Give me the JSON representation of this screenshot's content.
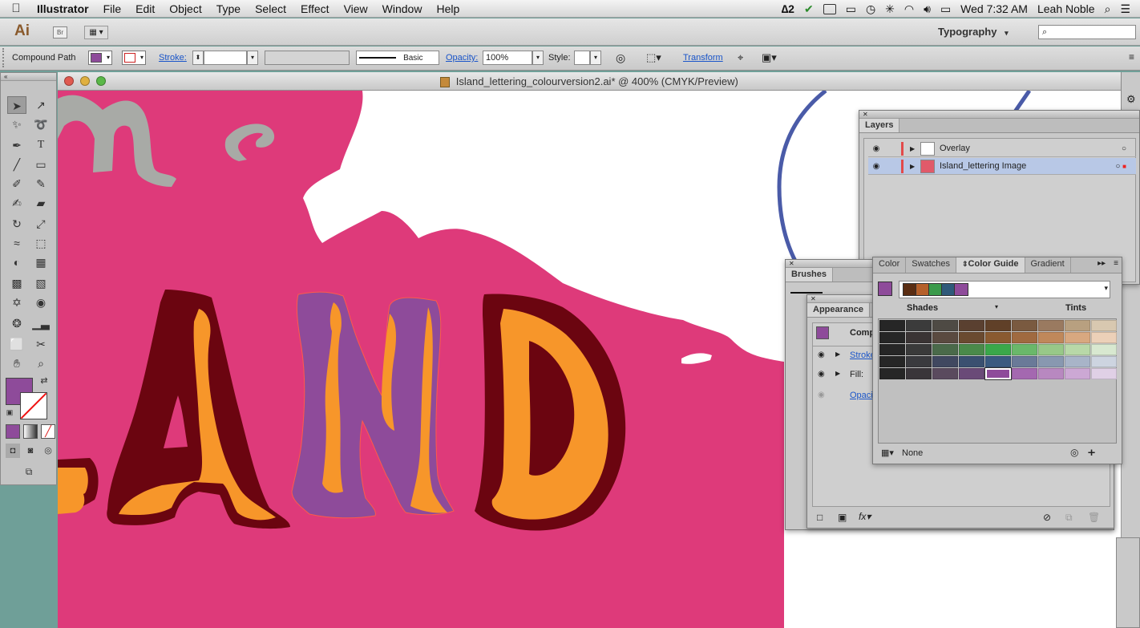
{
  "menubar": {
    "app_name": "Illustrator",
    "menus": [
      "File",
      "Edit",
      "Object",
      "Type",
      "Select",
      "Effect",
      "View",
      "Window",
      "Help"
    ],
    "status": {
      "adobe_count": "2",
      "clock": "Wed 7:32 AM",
      "user": "Leah Noble"
    }
  },
  "appbar": {
    "logo": "Ai",
    "bridge": "Br",
    "workspace": "Typography",
    "workspace_arrow": "▾",
    "search_placeholder": ""
  },
  "controlbar": {
    "selection_type": "Compound Path",
    "stroke_label": "Stroke:",
    "brush_label": "Basic",
    "opacity_label": "Opacity:",
    "opacity_value": "100%",
    "style_label": "Style:",
    "transform_label": "Transform",
    "fill_color": "#8e4b9a"
  },
  "document": {
    "title": "Island_lettering_colourversion2.ai* @ 400% (CMYK/Preview)"
  },
  "layers_panel": {
    "title": "Layers",
    "layers": [
      {
        "name": "Overlay",
        "selected": false
      },
      {
        "name": "Island_lettering Image",
        "selected": true
      }
    ]
  },
  "brushes_panel": {
    "title": "Brushes"
  },
  "appearance_panel": {
    "title": "Appearance",
    "item_label": "Comp",
    "rows": [
      "Stroke",
      "Fill:",
      "Opaci"
    ]
  },
  "color_guide_panel": {
    "tabs": [
      "Color",
      "Swatches",
      "Color Guide",
      "Gradient"
    ],
    "active_tab": "Color Guide",
    "shades_label": "Shades",
    "tints_label": "Tints",
    "footer_label": "None",
    "harmony_colors": [
      "#5a2d12",
      "#b5602a",
      "#3a9a4a",
      "#2f5a7a",
      "#8e4b9a"
    ],
    "grid_rows": [
      [
        "#262626",
        "#3b3b3b",
        "#4e4a44",
        "#5a4030",
        "#604028",
        "#7a5a40",
        "#9a7a60",
        "#b8a080",
        "#d8c8b0"
      ],
      [
        "#262626",
        "#3a3434",
        "#5a4a40",
        "#6a4a30",
        "#8a5a30",
        "#a06a40",
        "#c0885a",
        "#d8a880",
        "#ecd0b8"
      ],
      [
        "#262626",
        "#3a3a3a",
        "#4a6a4a",
        "#4a8a4a",
        "#3aa84a",
        "#6ab86a",
        "#98c888",
        "#b8d8a8",
        "#d8e8d0"
      ],
      [
        "#262626",
        "#3a3a3e",
        "#404860",
        "#3a5070",
        "#3a5a80",
        "#6a7a98",
        "#8898b0",
        "#a8b4c8",
        "#cdd4e0"
      ],
      [
        "#262626",
        "#3a363a",
        "#5a4a5e",
        "#6a4a78",
        "#8e4b9a",
        "#a468b0",
        "#b888c0",
        "#cca8d4",
        "#e0d0e6"
      ]
    ]
  },
  "tools": {
    "fill_color": "#8e4b9a"
  },
  "artwork": {
    "letters": [
      "L",
      "A",
      "N",
      "D"
    ],
    "pink": "#de3a7a",
    "dark_red": "#6b0510",
    "orange": "#f7962a",
    "purple": "#8e4b9a",
    "grey_text": "#a8aaa6",
    "blue_line": "#4a5ba8"
  }
}
